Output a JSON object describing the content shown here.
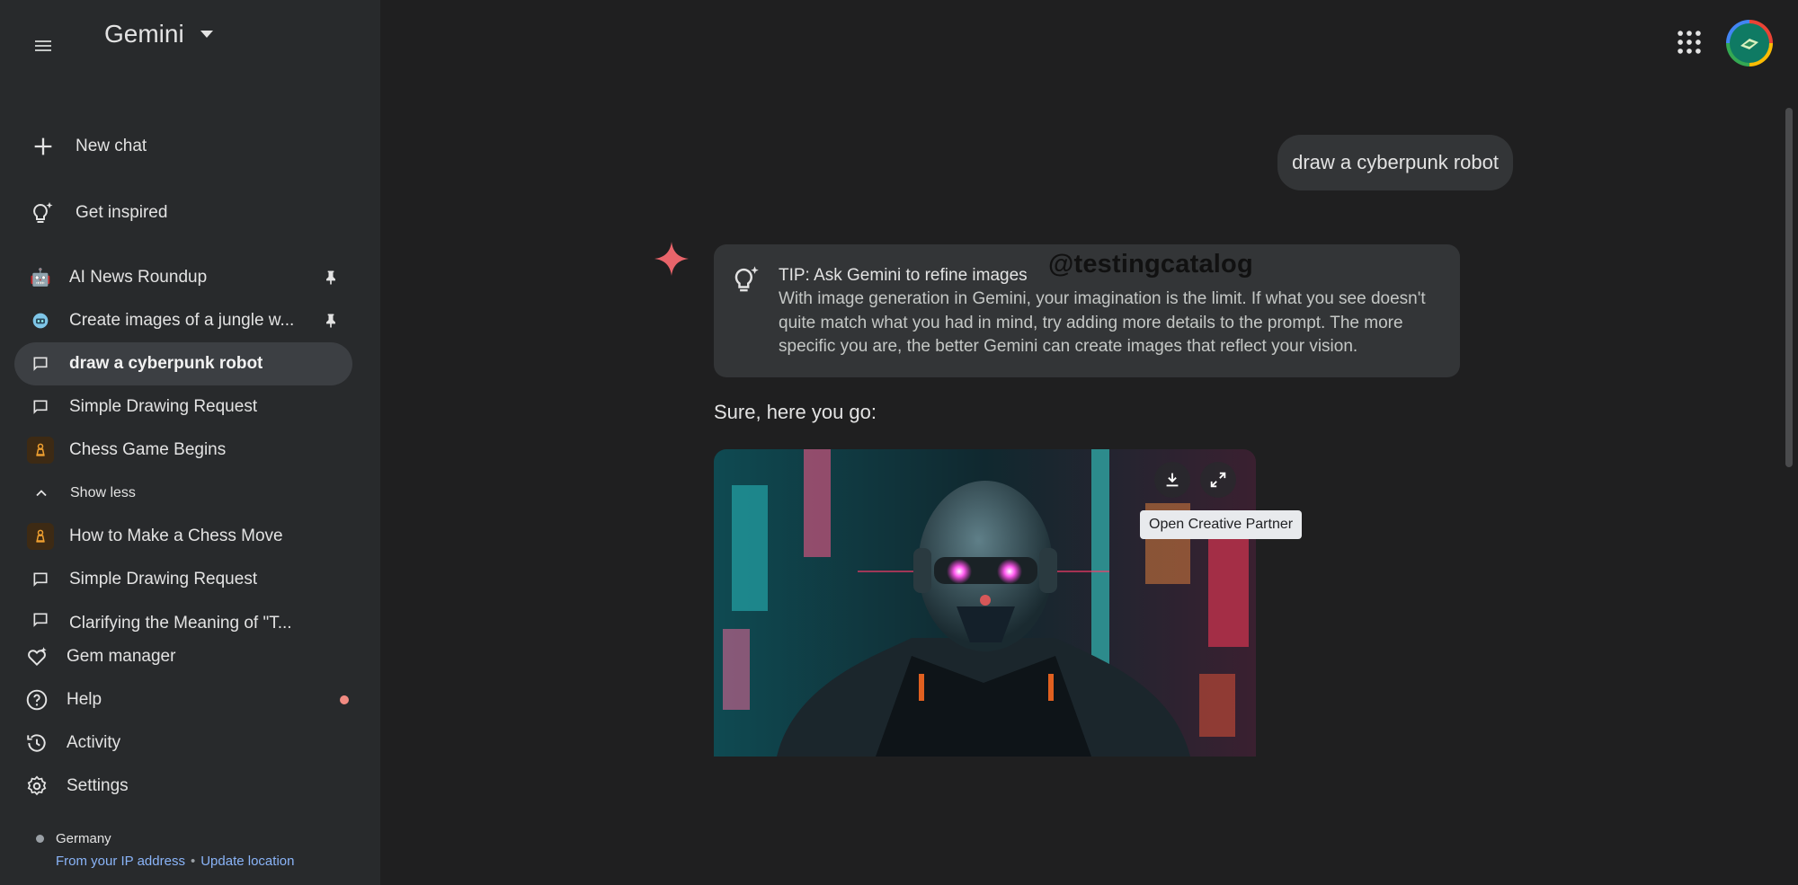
{
  "app": {
    "title": "Gemini"
  },
  "sidebar": {
    "new_chat": "New chat",
    "get_inspired": "Get inspired",
    "recent": [
      {
        "label": "AI News Roundup",
        "icon": "robot-emoji",
        "pinned": true
      },
      {
        "label": "Create images of a jungle w...",
        "icon": "robot-face-emoji",
        "pinned": true
      },
      {
        "label": "draw a cyberpunk robot",
        "icon": "chat-icon",
        "active": true
      },
      {
        "label": "Simple Drawing Request",
        "icon": "chat-icon"
      },
      {
        "label": "Chess Game Begins",
        "icon": "chess-pawn-icon"
      }
    ],
    "show_less": "Show less",
    "more_recent": [
      {
        "label": "How to Make a Chess Move",
        "icon": "chess-pawn-icon"
      },
      {
        "label": "Simple Drawing Request",
        "icon": "chat-icon"
      },
      {
        "label": "Clarifying the Meaning of \"T...",
        "icon": "chat-icon"
      }
    ],
    "bottom": {
      "gem_manager": "Gem manager",
      "help": "Help",
      "activity": "Activity",
      "settings": "Settings"
    },
    "location": {
      "country": "Germany",
      "source": "From your IP address",
      "separator": "•",
      "update": "Update location"
    }
  },
  "chat": {
    "user_prompt": "draw a cyberpunk robot",
    "tip_title": "TIP: Ask Gemini to refine images",
    "tip_body": "With image generation in Gemini, your imagination is the limit. If what you see doesn't quite match what you had in mind, try adding more details to the prompt. The more specific you are, the better Gemini can create images that reflect your vision.",
    "watermark": "@testingcatalog",
    "response": "Sure, here you go:",
    "tooltip": "Open Creative Partner"
  },
  "colors": {
    "background": "#1f1f20",
    "sidebar": "#282a2c",
    "active_item": "#3c3f43",
    "bubble": "#333537",
    "link": "#8ab4f8",
    "sparkle": "#e8646a",
    "help_dot": "#f28b82"
  }
}
